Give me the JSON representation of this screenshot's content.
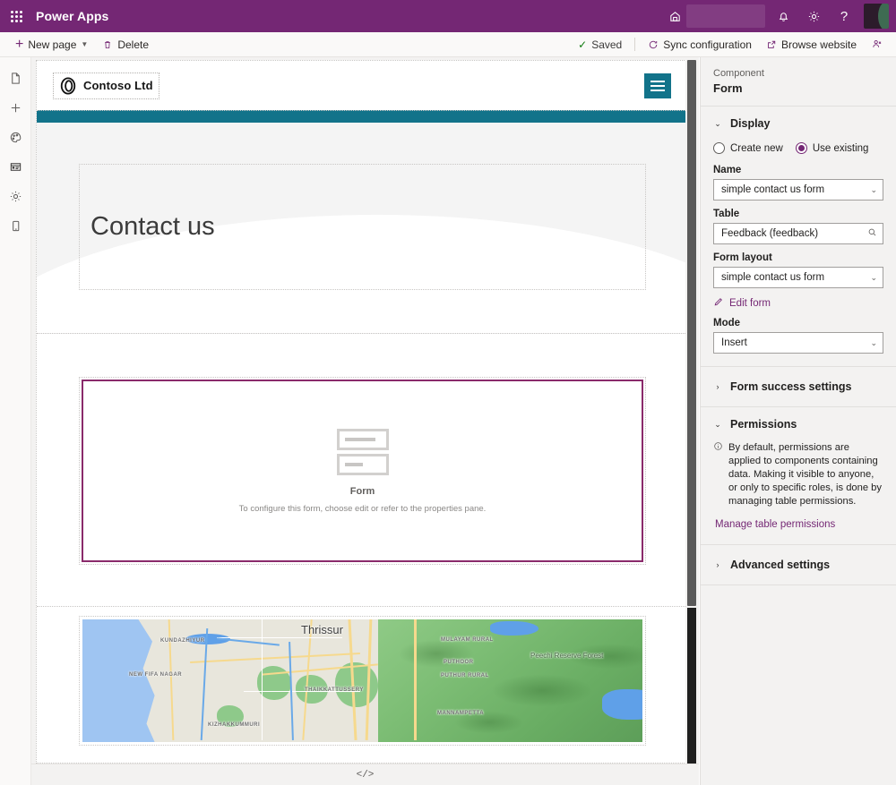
{
  "appbar": {
    "waffle_icon": "app-launcher-icon",
    "title": "Power Apps",
    "environment_icon": "environment-icon",
    "notifications_icon": "bell-icon",
    "settings_icon": "gear-icon",
    "help_icon": "question-icon",
    "avatar": "user-avatar",
    "brand_color": "#742774"
  },
  "commandbar": {
    "new_page": "New page",
    "delete": "Delete",
    "saved": "Saved",
    "sync_configuration": "Sync configuration",
    "browse_website": "Browse website",
    "pin_icon": "pin-pane-icon"
  },
  "rail": {
    "items": [
      {
        "name": "pages-icon",
        "glyph": "page"
      },
      {
        "name": "add-icon",
        "glyph": "plus"
      },
      {
        "name": "theme-icon",
        "glyph": "palette"
      },
      {
        "name": "data-icon",
        "glyph": "data"
      },
      {
        "name": "settings-icon",
        "glyph": "gear"
      },
      {
        "name": "mobile-preview-icon",
        "glyph": "mobile"
      }
    ]
  },
  "canvas": {
    "site_header": {
      "logo_text": "Contoso Ltd",
      "menu_icon": "hamburger-menu-icon",
      "accent_color": "#12738a"
    },
    "hero": {
      "title": "Contact us"
    },
    "form_component": {
      "label": "Form",
      "description": "To configure this form, choose edit or refer to the properties pane.",
      "selected_border_color": "#8a2a6b"
    },
    "map": {
      "city_label": "Thrissur",
      "labels": [
        "KUNDAZHIYUR",
        "NEW FIFA NAGAR",
        "MULAYAM RURAL",
        "PUTHOOR",
        "PUTHUR RURAL",
        "THAIKKATTUSSERY",
        "MANNAMPETTA",
        "KIZHAKKUMMURI"
      ],
      "park_label": "Peechi Reserve Forest"
    },
    "bottom_bar": {
      "code_button": "</>"
    }
  },
  "pane": {
    "eyebrow": "Component",
    "title": "Form",
    "display": {
      "section_title": "Display",
      "chevron": "expanded",
      "radio_create_new": "Create new",
      "radio_use_existing": "Use existing",
      "selected_radio": "Use existing",
      "name_label": "Name",
      "name_value": "simple contact us form",
      "table_label": "Table",
      "table_value": "Feedback (feedback)",
      "form_layout_label": "Form layout",
      "form_layout_value": "simple contact us form",
      "edit_form_link": "Edit form",
      "mode_label": "Mode",
      "mode_value": "Insert"
    },
    "form_success": {
      "section_title": "Form success settings",
      "chevron": "collapsed"
    },
    "permissions": {
      "section_title": "Permissions",
      "chevron": "expanded",
      "note": "By default, permissions are applied to components containing data. Making it visible to anyone, or only to specific roles, is done by managing table permissions.",
      "link": "Manage table permissions"
    },
    "advanced": {
      "section_title": "Advanced settings",
      "chevron": "collapsed"
    },
    "accent_color": "#742774"
  }
}
